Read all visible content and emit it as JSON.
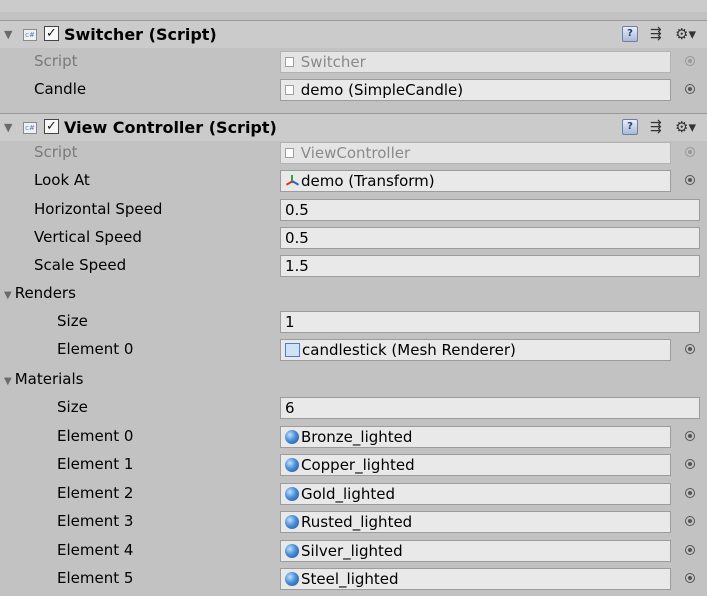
{
  "switcher": {
    "title": "Switcher (Script)",
    "script_label": "Script",
    "script_value": "Switcher",
    "candle_label": "Candle",
    "candle_value": "demo (SimpleCandle)"
  },
  "view_controller": {
    "title": "View Controller (Script)",
    "script_label": "Script",
    "script_value": "ViewController",
    "look_at_label": "Look At",
    "look_at_value": "demo (Transform)",
    "horizontal_speed_label": "Horizontal Speed",
    "horizontal_speed_value": "0.5",
    "vertical_speed_label": "Vertical Speed",
    "vertical_speed_value": "0.5",
    "scale_speed_label": "Scale Speed",
    "scale_speed_value": "1.5",
    "renders": {
      "label": "Renders",
      "size_label": "Size",
      "size_value": "1",
      "elements": [
        {
          "label": "Element 0",
          "value": "candlestick (Mesh Renderer)"
        }
      ]
    },
    "materials": {
      "label": "Materials",
      "size_label": "Size",
      "size_value": "6",
      "elements": [
        {
          "label": "Element 0",
          "value": "Bronze_lighted"
        },
        {
          "label": "Element 1",
          "value": "Copper_lighted"
        },
        {
          "label": "Element 2",
          "value": "Gold_lighted"
        },
        {
          "label": "Element 3",
          "value": "Rusted_lighted"
        },
        {
          "label": "Element 4",
          "value": "Silver_lighted"
        },
        {
          "label": "Element 5",
          "value": "Steel_lighted"
        }
      ]
    }
  },
  "icons": {
    "fold": "foldout-arrow-icon",
    "cs": "cs-script-icon",
    "help": "help-book-icon",
    "preset": "preset-sliders-icon",
    "gear": "gear-icon",
    "picker": "object-picker-icon",
    "material": "material-sphere-icon",
    "mesh": "mesh-renderer-icon",
    "transform": "transform-axis-icon"
  }
}
